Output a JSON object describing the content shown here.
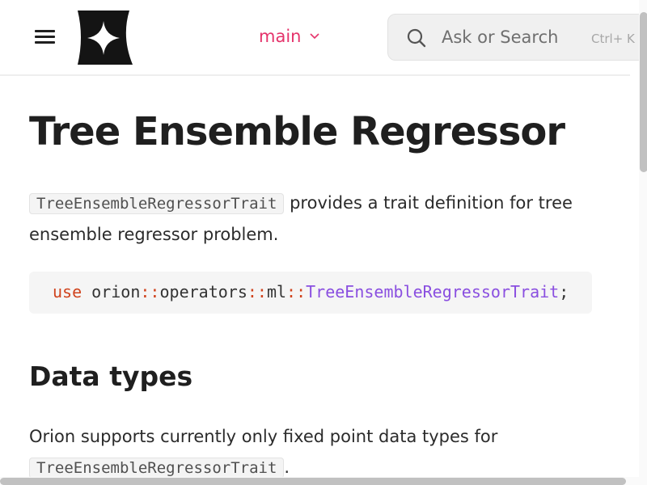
{
  "header": {
    "branch_label": "main",
    "search": {
      "placeholder": "Ask or Search",
      "shortcut": "Ctrl+ K"
    }
  },
  "page": {
    "title": "Tree Ensemble Regressor",
    "intro": {
      "code": "TreeEnsembleRegressorTrait",
      "text": " provides a trait definition for tree ensemble regressor problem."
    },
    "code_block": {
      "keyword": "use",
      "crate": "orion",
      "sep1": "::",
      "module1": "operators",
      "sep2": "::",
      "module2": "ml",
      "sep3": "::",
      "type_name": "TreeEnsembleRegressorTrait",
      "terminator": ";"
    },
    "section_heading": "Data types",
    "data_types": {
      "text": "Orion supports currently only fixed point data types for ",
      "code": "TreeEnsembleRegressorTrait",
      "suffix": "."
    }
  },
  "colors": {
    "accent": "#e5336b",
    "keyword": "#d0441e",
    "type": "#8a4fe0"
  },
  "icons": [
    "hamburger-menu-icon",
    "brand-logo-icon",
    "chevron-down-icon",
    "search-icon"
  ]
}
